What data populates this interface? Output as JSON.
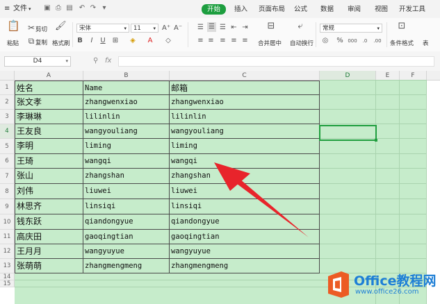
{
  "menubar": {
    "file_label": "文件",
    "tabs": [
      "开始",
      "插入",
      "页面布局",
      "公式",
      "数据",
      "审阅",
      "视图",
      "开发工具"
    ],
    "active_tab": "开始"
  },
  "ribbon": {
    "paste": "粘贴",
    "cut": "剪切",
    "copy": "复制",
    "format_painter": "格式刷",
    "font_name": "宋体",
    "font_size": "11",
    "merge_center": "合并居中",
    "wrap_text": "自动换行",
    "number_format": "常规",
    "conditional_format": "条件格式",
    "table_style": "表"
  },
  "formula_bar": {
    "name_box": "D4",
    "fx": "fx",
    "zoom_icon": "zoom-icon",
    "formula": ""
  },
  "sheet": {
    "columns": [
      "A",
      "B",
      "C",
      "D",
      "E",
      "F"
    ],
    "selected_column": "D",
    "rows": [
      "1",
      "2",
      "3",
      "4",
      "5",
      "6",
      "7",
      "8",
      "9",
      "10",
      "11",
      "12",
      "13",
      "14",
      "15"
    ],
    "selected_row": "4",
    "data": [
      [
        "姓名",
        "Name",
        "邮箱"
      ],
      [
        "张文孝",
        "zhangwenxiao",
        "zhangwenxiao"
      ],
      [
        "李琳琳",
        "lilinlin",
        "lilinlin"
      ],
      [
        "王友良",
        "wangyouliang",
        "wangyouliang"
      ],
      [
        "李明",
        "liming",
        "liming"
      ],
      [
        "王琦",
        "wangqi",
        "wangqi"
      ],
      [
        "张山",
        "zhangshan",
        "zhangshan"
      ],
      [
        "刘伟",
        "liuwei",
        "liuwei"
      ],
      [
        "林思齐",
        "linsiqi",
        "linsiqi"
      ],
      [
        "钱东跃",
        "qiandongyue",
        "qiandongyue"
      ],
      [
        "高庆田",
        "gaoqingtian",
        "gaoqingtian"
      ],
      [
        "王月月",
        "wangyuyue",
        "wangyuyue"
      ],
      [
        "张萌萌",
        "zhangmengmeng",
        "zhangmengmeng"
      ]
    ],
    "fill_color": "#c6eccb",
    "selection_color": "#1f9e3e"
  },
  "annotation": {
    "arrow_color": "#e8242b"
  },
  "watermark": {
    "title": "Office教程网",
    "subtitle": "www.office26.com",
    "brand_color": "#1e7fd6",
    "logo_color": "#ec5b24"
  }
}
